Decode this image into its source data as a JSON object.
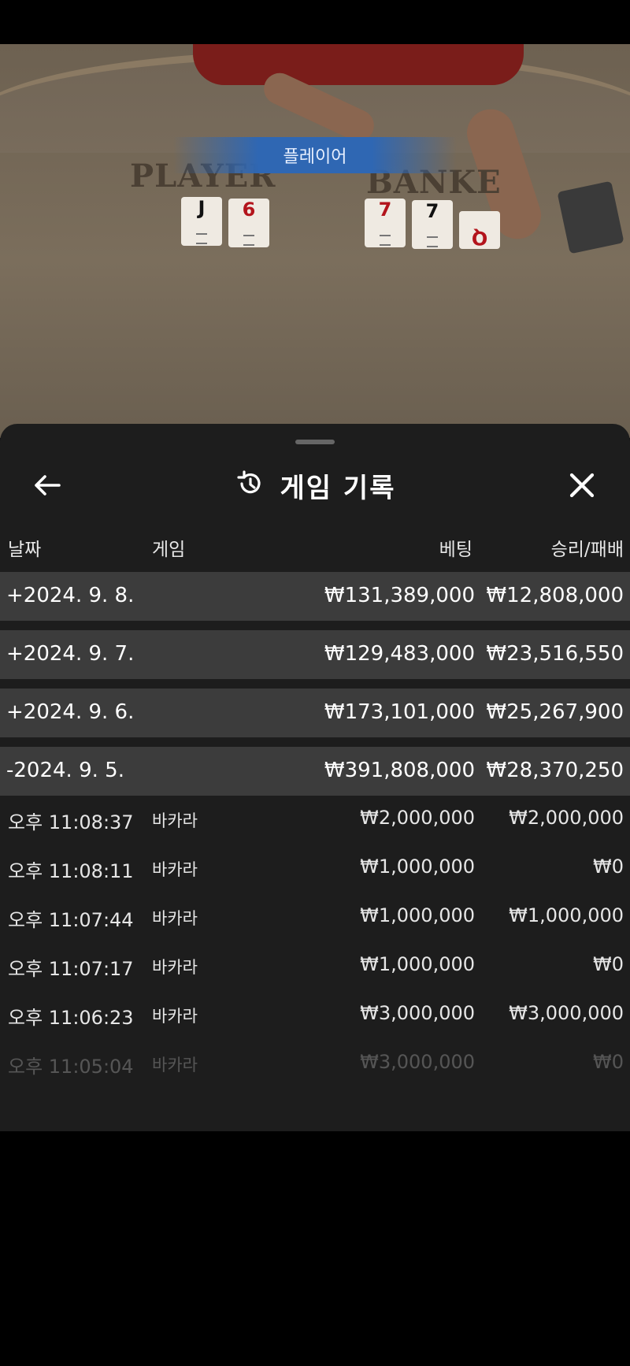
{
  "video": {
    "banner_label": "플레이어",
    "felt_player": "PLAYER",
    "felt_banker": "BANKE",
    "player_cards": [
      {
        "rank": "J",
        "color": "black"
      },
      {
        "rank": "6",
        "color": "red"
      }
    ],
    "banker_cards": [
      {
        "rank": "7",
        "color": "red"
      },
      {
        "rank": "7",
        "color": "black"
      },
      {
        "rank": "Q",
        "color": "red"
      }
    ]
  },
  "sheet": {
    "title": "게임 기록",
    "back_icon": "arrow-left-icon",
    "history_icon": "history-icon",
    "close_icon": "close-icon"
  },
  "columns": {
    "date": "날짜",
    "game": "게임",
    "bet": "베팅",
    "win": "승리/패배"
  },
  "days": [
    {
      "date": "+2024. 9. 8.",
      "bet": "₩131,389,000",
      "win": "₩12,808,000"
    },
    {
      "date": "+2024. 9. 7.",
      "bet": "₩129,483,000",
      "win": "₩23,516,550"
    },
    {
      "date": "+2024. 9. 6.",
      "bet": "₩173,101,000",
      "win": "₩25,267,900"
    },
    {
      "date": "-2024. 9. 5.",
      "bet": "₩391,808,000",
      "win": "₩28,370,250"
    }
  ],
  "details": [
    {
      "time": "오후 11:08:37",
      "game": "바카라",
      "bet": "₩2,000,000",
      "win": "₩2,000,000"
    },
    {
      "time": "오후 11:08:11",
      "game": "바카라",
      "bet": "₩1,000,000",
      "win": "₩0"
    },
    {
      "time": "오후 11:07:44",
      "game": "바카라",
      "bet": "₩1,000,000",
      "win": "₩1,000,000"
    },
    {
      "time": "오후 11:07:17",
      "game": "바카라",
      "bet": "₩1,000,000",
      "win": "₩0"
    },
    {
      "time": "오후 11:06:23",
      "game": "바카라",
      "bet": "₩3,000,000",
      "win": "₩3,000,000"
    },
    {
      "time": "오후 11:05:04",
      "game": "바카라",
      "bet": "₩3,000,000",
      "win": "₩0"
    }
  ]
}
